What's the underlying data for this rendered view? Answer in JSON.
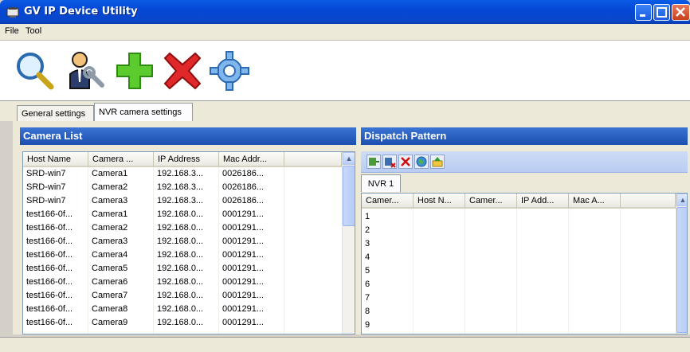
{
  "window": {
    "title": "GV IP Device Utility"
  },
  "menu": [
    "File",
    "Tool"
  ],
  "toolbar": [
    {
      "icon": "search-icon"
    },
    {
      "icon": "user-wrench-icon"
    },
    {
      "icon": "add-icon"
    },
    {
      "icon": "delete-icon"
    },
    {
      "icon": "gear-icon"
    }
  ],
  "tabs": [
    "General settings",
    "NVR camera settings"
  ],
  "camera_list": {
    "title": "Camera List",
    "columns": [
      "Host Name",
      "Camera ...",
      "IP Address",
      "Mac Addr..."
    ],
    "rows": [
      [
        "SRD-win7",
        "Camera1",
        "192.168.3...",
        "0026186..."
      ],
      [
        "SRD-win7",
        "Camera2",
        "192.168.3...",
        "0026186..."
      ],
      [
        "SRD-win7",
        "Camera3",
        "192.168.3...",
        "0026186..."
      ],
      [
        "test166-0f...",
        "Camera1",
        "192.168.0...",
        "0001291..."
      ],
      [
        "test166-0f...",
        "Camera2",
        "192.168.0...",
        "0001291..."
      ],
      [
        "test166-0f...",
        "Camera3",
        "192.168.0...",
        "0001291..."
      ],
      [
        "test166-0f...",
        "Camera4",
        "192.168.0...",
        "0001291..."
      ],
      [
        "test166-0f...",
        "Camera5",
        "192.168.0...",
        "0001291..."
      ],
      [
        "test166-0f...",
        "Camera6",
        "192.168.0...",
        "0001291..."
      ],
      [
        "test166-0f...",
        "Camera7",
        "192.168.0...",
        "0001291..."
      ],
      [
        "test166-0f...",
        "Camera8",
        "192.168.0...",
        "0001291..."
      ],
      [
        "test166-0f...",
        "Camera9",
        "192.168.0...",
        "0001291..."
      ]
    ]
  },
  "dispatch": {
    "title": "Dispatch Pattern",
    "buttons": [
      "add-row-icon",
      "remove-row-icon",
      "delete-icon",
      "globe-icon",
      "export-icon"
    ],
    "nvr_tab": "NVR 1",
    "columns": [
      "Camer...",
      "Host N...",
      "Camer...",
      "IP Add...",
      "Mac A..."
    ],
    "rows": [
      "1",
      "2",
      "3",
      "4",
      "5",
      "6",
      "7",
      "8",
      "9"
    ]
  }
}
